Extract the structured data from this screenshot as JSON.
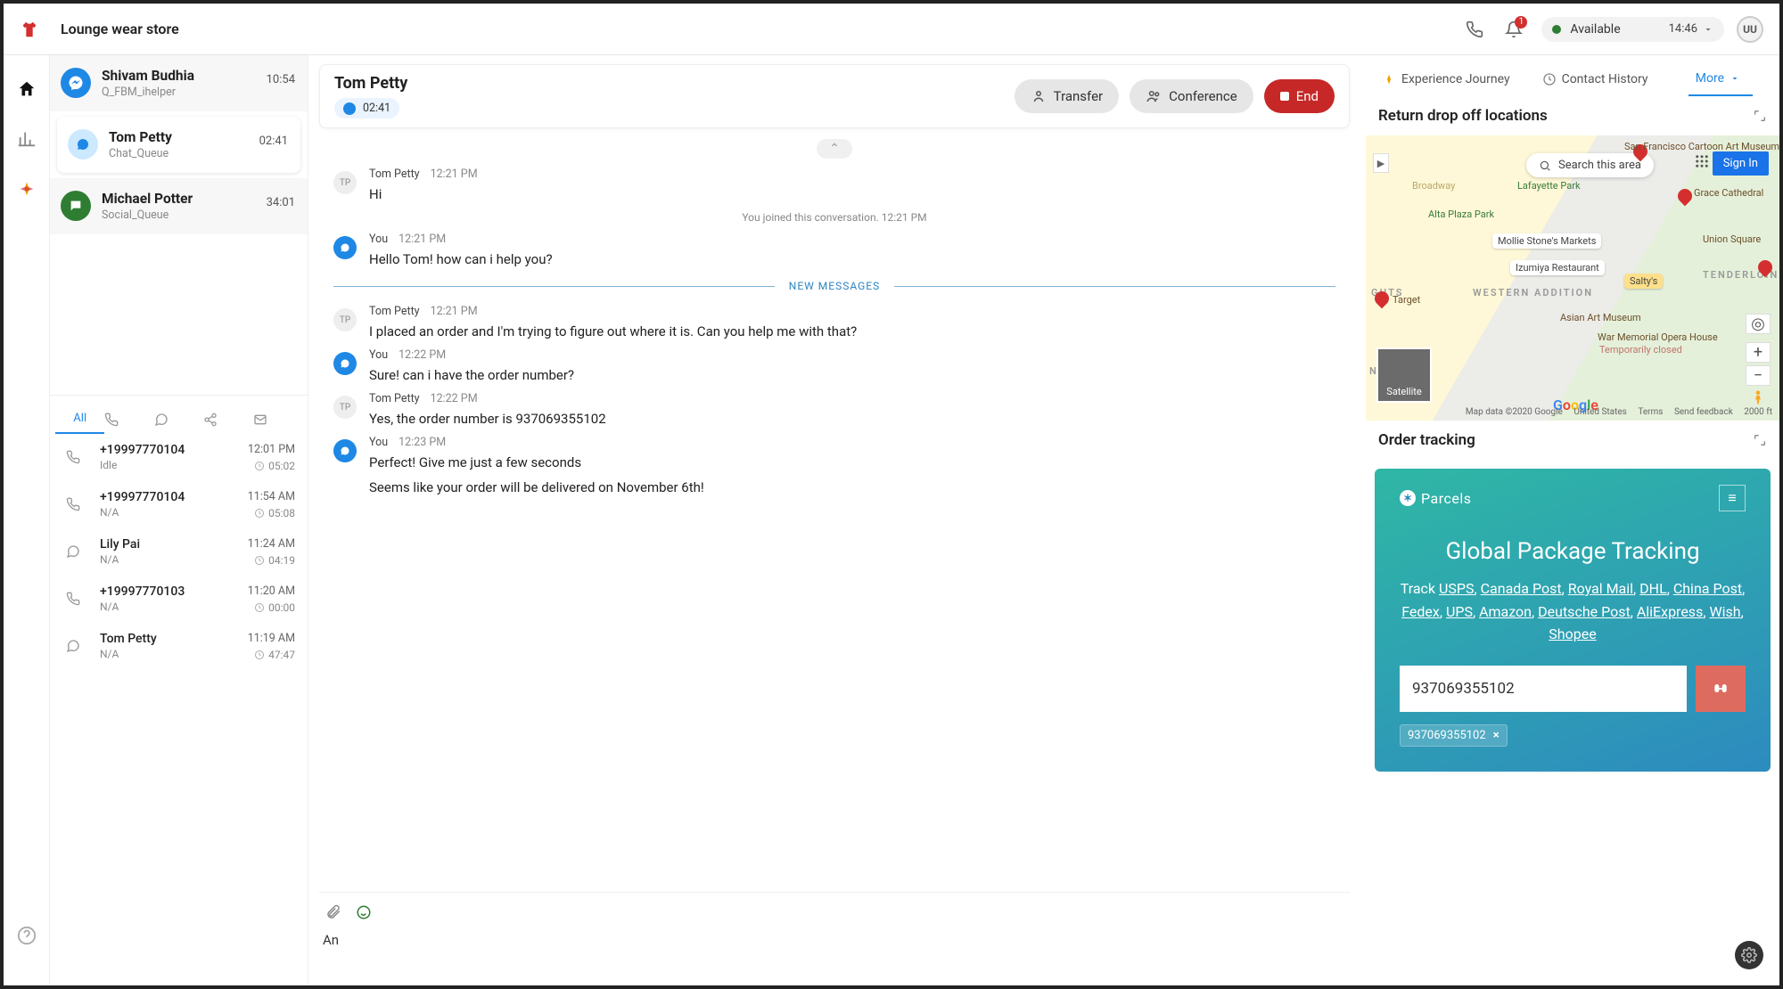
{
  "topbar": {
    "title": "Lounge wear store",
    "status_label": "Available",
    "time": "14:46",
    "notif_count": "1",
    "avatar_initials": "UU"
  },
  "conversations": [
    {
      "name": "Shivam Budhia",
      "sub": "Q_FBM_ihelper",
      "time": "10:54",
      "channel": "fb"
    },
    {
      "name": "Tom Petty",
      "sub": "Chat_Queue",
      "time": "02:41",
      "channel": "chat"
    },
    {
      "name": "Michael Potter",
      "sub": "Social_Queue",
      "time": "34:01",
      "channel": "sms"
    }
  ],
  "conv_tabs": {
    "all": "All"
  },
  "history": [
    {
      "p": "+19997770104",
      "s": "Idle",
      "t": "12:01 PM",
      "d": "05:02",
      "icon": "phone"
    },
    {
      "p": "+19997770104",
      "s": "N/A",
      "t": "11:54 AM",
      "d": "05:08",
      "icon": "phone"
    },
    {
      "p": "Lily Pai",
      "s": "N/A",
      "t": "11:24 AM",
      "d": "04:19",
      "icon": "chat"
    },
    {
      "p": "+19997770103",
      "s": "N/A",
      "t": "11:20 AM",
      "d": "00:00",
      "icon": "phone"
    },
    {
      "p": "Tom Petty",
      "s": "N/A",
      "t": "11:19 AM",
      "d": "47:47",
      "icon": "chat"
    }
  ],
  "chat": {
    "customer": "Tom Petty",
    "timer": "02:41",
    "actions": {
      "transfer": "Transfer",
      "conference": "Conference",
      "end": "End"
    },
    "sys_join": "You joined this conversation. 12:21 PM",
    "new_label": "NEW MESSAGES",
    "msgs": [
      {
        "who": "Tom Petty",
        "time": "12:21 PM",
        "avatar": "TP",
        "body": [
          "Hi"
        ]
      },
      {
        "who": "You",
        "time": "12:21 PM",
        "avatar": "you",
        "body": [
          "Hello Tom! how can i help you?"
        ]
      },
      {
        "who": "Tom Petty",
        "time": "12:21 PM",
        "avatar": "TP",
        "body": [
          "I placed an order and I'm trying to figure out where it is. Can you help me with that?"
        ]
      },
      {
        "who": "You",
        "time": "12:22 PM",
        "avatar": "you",
        "body": [
          "Sure! can i have the order number?"
        ]
      },
      {
        "who": "Tom Petty",
        "time": "12:22 PM",
        "avatar": "TP",
        "body": [
          "Yes, the order number is 937069355102"
        ]
      },
      {
        "who": "You",
        "time": "12:23 PM",
        "avatar": "you",
        "body": [
          "Perfect! Give me just a few seconds",
          "Seems like your order will be delivered on November 6th!"
        ]
      }
    ],
    "compose": "An"
  },
  "right": {
    "tabs": {
      "journey": "Experience Journey",
      "history": "Contact History",
      "more": "More"
    },
    "sec1_title": "Return drop off locations",
    "map": {
      "search": "Search this area",
      "signin": "Sign In",
      "satellite": "Satellite",
      "places": {
        "sf_cartoon": "San Francisco Cartoon Art Museum",
        "grace": "Grace Cathedral",
        "mollie": "Mollie Stone's Markets",
        "izumiya": "Izumiya Restaurant",
        "saltys": "Salty's",
        "asian": "Asian Art Museum",
        "target": "Target",
        "alta": "Alta Plaza Park",
        "war": "War Memorial Opera House",
        "war2": "Temporarily closed",
        "hoods": {
          "ghts": "GHTS",
          "western": "WESTERN ADDITION",
          "tenderloin": "TENDERLOIN",
          "nhandle": "NHANDLE",
          "union": "Union Square",
          "broadway": "Broadway",
          "laf": "Lafayette Park"
        }
      },
      "footer": {
        "mapdata": "Map data ©2020 Google",
        "us": "United States",
        "terms": "Terms",
        "feedback": "Send feedback",
        "scale": "2000 ft"
      }
    },
    "sec2_title": "Order tracking",
    "track": {
      "brand": "Parcels",
      "h1": "Global Package Tracking",
      "pre": "Track ",
      "carriers": [
        "USPS",
        "Canada Post",
        "Royal Mail",
        "DHL",
        "China Post",
        "Fedex",
        "UPS",
        "Amazon",
        "Deutsche Post",
        "AliExpress",
        "Wish",
        "Shopee"
      ],
      "input": "937069355102",
      "chip": "937069355102"
    }
  }
}
